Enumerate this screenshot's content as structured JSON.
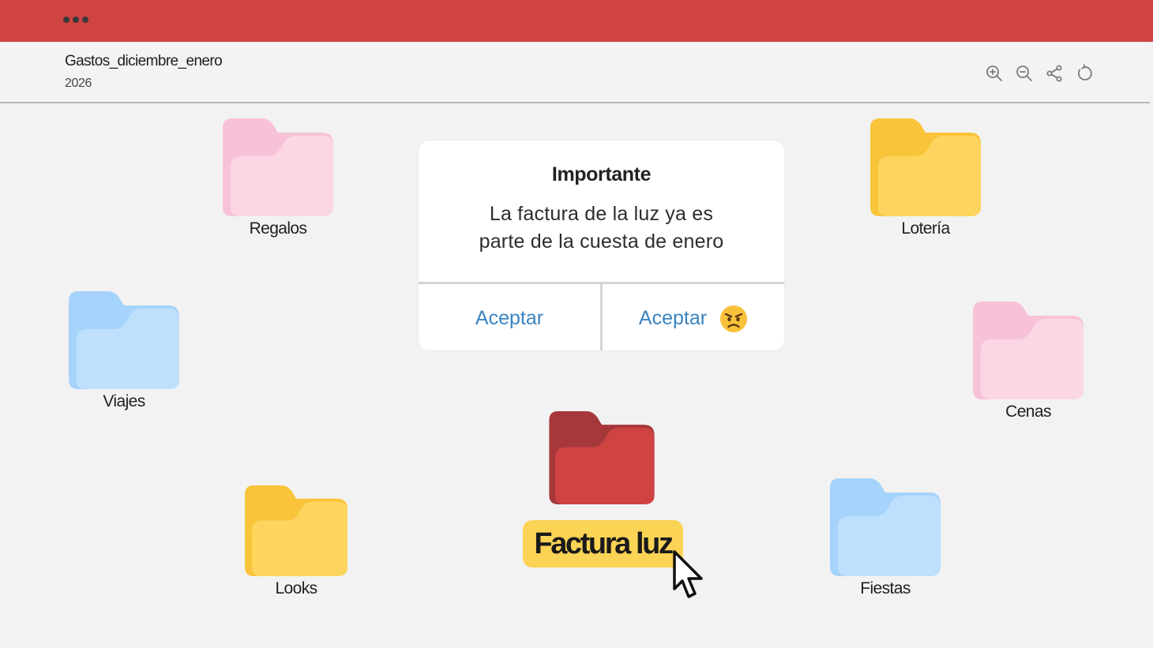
{
  "window": {
    "controls": [
      "dot",
      "dot",
      "dot"
    ]
  },
  "header": {
    "title": "Gastos_diciembre_enero",
    "subtitle": "2026"
  },
  "toolbar": {
    "items": [
      {
        "icon": "zoom-in-icon"
      },
      {
        "icon": "zoom-out-icon"
      },
      {
        "icon": "share-icon"
      },
      {
        "icon": "refresh-icon"
      }
    ]
  },
  "colors": {
    "titlebar": "#cf4343",
    "pink_folder": "#f9d3e2",
    "yellow_folder": "#fbd355",
    "blue_folder": "#bcdffd",
    "red_folder": "#cf4343",
    "link": "#3a83bf"
  },
  "folders": [
    {
      "id": "regalos",
      "label": "Regalos",
      "color": "pink"
    },
    {
      "id": "loteria",
      "label": "Lotería",
      "color": "yellow"
    },
    {
      "id": "viajes",
      "label": "Viajes",
      "color": "blue"
    },
    {
      "id": "cenas",
      "label": "Cenas",
      "color": "pink"
    },
    {
      "id": "looks",
      "label": "Looks",
      "color": "yellow"
    },
    {
      "id": "fiestas",
      "label": "Fiestas",
      "color": "blue"
    },
    {
      "id": "factura",
      "label": "Factura luz",
      "color": "red",
      "selected": true
    }
  ],
  "dialog": {
    "title": "Importante",
    "message_line1": "La factura de la luz ya es",
    "message_line2": "parte de la cuesta de enero",
    "buttons": [
      {
        "label": "Aceptar"
      },
      {
        "label": "Aceptar",
        "emoji": "😠"
      }
    ]
  }
}
